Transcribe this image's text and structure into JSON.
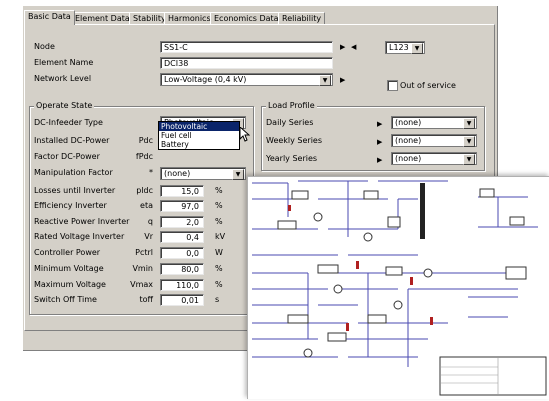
{
  "tabs": [
    "Basic Data",
    "Element Data",
    "Stability",
    "Harmonics",
    "Economics Data",
    "Reliability"
  ],
  "node": {
    "label": "Node",
    "value": "SS1-C",
    "right_value": "L123"
  },
  "element_name": {
    "label": "Element Name",
    "value": "DCI38"
  },
  "network_level": {
    "label": "Network Level",
    "value": "Low-Voltage (0,4 kV)"
  },
  "out_of_service": {
    "label": "Out of service"
  },
  "operate_state": {
    "title": "Operate State",
    "infeeder_type": {
      "label": "DC-Infeeder Type",
      "value": "Photovoltaic",
      "options": [
        "Photovoltaic",
        "Fuel cell",
        "Battery"
      ]
    },
    "rows": [
      {
        "label": "Installed DC-Power",
        "symbol": "Pdc",
        "value": "",
        "unit": ""
      },
      {
        "label": "Factor DC-Power",
        "symbol": "fPdc",
        "value": "",
        "unit": ""
      },
      {
        "label": "Manipulation Factor",
        "symbol": "*",
        "value": "(none)",
        "unit": ""
      },
      {
        "label": "Losses until Inverter",
        "symbol": "pldc",
        "value": "15,0",
        "unit": "%"
      },
      {
        "label": "Efficiency Inverter",
        "symbol": "eta",
        "value": "97,0",
        "unit": "%"
      },
      {
        "label": "Reactive Power Inverter",
        "symbol": "q",
        "value": "2,0",
        "unit": "%"
      },
      {
        "label": "Rated Voltage Inverter",
        "symbol": "Vr",
        "value": "0,4",
        "unit": "kV"
      },
      {
        "label": "Controller Power",
        "symbol": "Pctrl",
        "value": "0,0",
        "unit": "W"
      },
      {
        "label": "Minimum Voltage",
        "symbol": "Vmin",
        "value": "80,0",
        "unit": "%"
      },
      {
        "label": "Maximum Voltage",
        "symbol": "Vmax",
        "value": "110,0",
        "unit": "%"
      },
      {
        "label": "Switch Off Time",
        "symbol": "toff",
        "value": "0,01",
        "unit": "s"
      }
    ]
  },
  "load_profile": {
    "title": "Load Profile",
    "rows": [
      {
        "label": "Daily Series",
        "value": "(none)"
      },
      {
        "label": "Weekly Series",
        "value": "(none)"
      },
      {
        "label": "Yearly Series",
        "value": "(none)"
      }
    ]
  },
  "icons": {
    "dropdown": "chevron-down-icon",
    "next": "play-right-icon",
    "prev": "play-left-icon",
    "cursor": "mouse-pointer-icon"
  },
  "colors": {
    "dialog": "#d4d0c8",
    "selection": "#0a246a",
    "diagram_lines": "#4a4ab0"
  }
}
